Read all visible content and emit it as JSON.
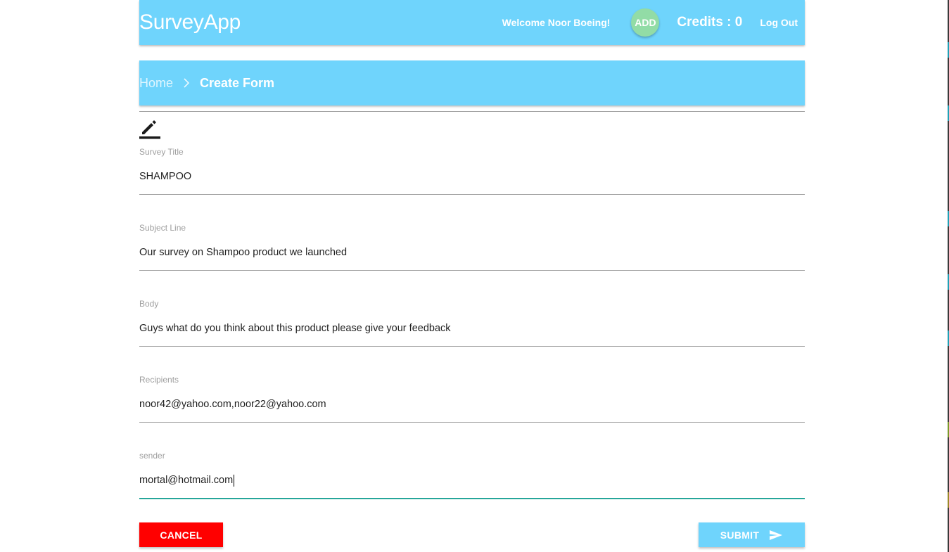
{
  "navbar": {
    "brand": "SurveyApp",
    "welcome": "Welcome Noor Boeing!",
    "add_label": "ADD",
    "credits": "Credits : 0",
    "logout": "Log Out"
  },
  "breadcrumb": {
    "home": "Home",
    "current": "Create Form"
  },
  "form": {
    "icon": "edit-icon",
    "fields": [
      {
        "label": "Survey Title",
        "value": "SHAMPOO"
      },
      {
        "label": "Subject Line",
        "value": "Our survey on Shampoo product we launched"
      },
      {
        "label": "Body",
        "value": "Guys what do you think about this product please give your feedback"
      },
      {
        "label": "Recipients",
        "value": "noor42@yahoo.com,noor22@yahoo.com"
      },
      {
        "label": "sender",
        "value": "mortal@hotmail.com"
      }
    ]
  },
  "buttons": {
    "cancel": "CANCEL",
    "submit": "SUBMIT"
  },
  "colors": {
    "primary": "#6fd4fc",
    "add_button": "#92dca6",
    "cancel": "#ff0000",
    "active_underline": "#26a69a"
  }
}
